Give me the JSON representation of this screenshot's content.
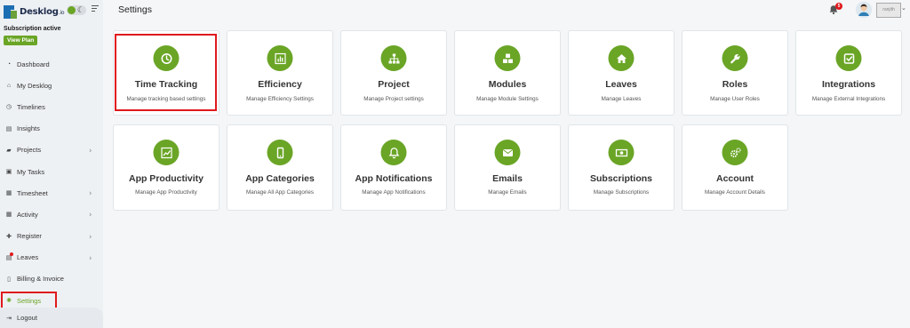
{
  "brand": {
    "name": "Desklog",
    "suffix": ".io"
  },
  "subscription": {
    "status": "Subscription active",
    "view_plan_label": "View Plan"
  },
  "nav": {
    "items": [
      {
        "label": "Dashboard",
        "icon": "dashboard-icon",
        "has_submenu": false
      },
      {
        "label": "My Desklog",
        "icon": "home-icon",
        "has_submenu": false
      },
      {
        "label": "Timelines",
        "icon": "clock-icon",
        "has_submenu": false
      },
      {
        "label": "Insights",
        "icon": "file-icon",
        "has_submenu": false
      },
      {
        "label": "Projects",
        "icon": "folder-icon",
        "has_submenu": true
      },
      {
        "label": "My Tasks",
        "icon": "tasks-icon",
        "has_submenu": false
      },
      {
        "label": "Timesheet",
        "icon": "calendar-icon",
        "has_submenu": true
      },
      {
        "label": "Activity",
        "icon": "grid-icon",
        "has_submenu": true
      },
      {
        "label": "Register",
        "icon": "plus-icon",
        "has_submenu": true
      },
      {
        "label": "Leaves",
        "icon": "leaves-icon",
        "has_submenu": true
      },
      {
        "label": "Billing & Invoice",
        "icon": "invoice-icon",
        "has_submenu": false
      },
      {
        "label": "Settings",
        "icon": "gear-icon",
        "has_submenu": false,
        "active": true
      },
      {
        "label": "Logout",
        "icon": "logout-icon",
        "has_submenu": false
      }
    ]
  },
  "header": {
    "title": "Settings",
    "notification_count": "5",
    "user_name": "ranjith"
  },
  "cards": [
    {
      "title": "Time Tracking",
      "desc": "Manage tracking based settings",
      "icon": "clock-icon"
    },
    {
      "title": "Efficiency",
      "desc": "Manage Efficiency Settings",
      "icon": "bar-chart-icon"
    },
    {
      "title": "Project",
      "desc": "Manage Project settings",
      "icon": "sitemap-icon"
    },
    {
      "title": "Modules",
      "desc": "Manage Module Settings",
      "icon": "cubes-icon"
    },
    {
      "title": "Leaves",
      "desc": "Manage Leaves",
      "icon": "home-icon"
    },
    {
      "title": "Roles",
      "desc": "Manage User Roles",
      "icon": "wrench-icon"
    },
    {
      "title": "Integrations",
      "desc": "Manage External Integrations",
      "icon": "check-square-icon"
    },
    {
      "title": "App Productivity",
      "desc": "Manage App Productivity",
      "icon": "trend-chart-icon"
    },
    {
      "title": "App Categories",
      "desc": "Manage All App Categories",
      "icon": "mobile-icon"
    },
    {
      "title": "App Notifications",
      "desc": "Manage App Notifications",
      "icon": "bell-icon"
    },
    {
      "title": "Emails",
      "desc": "Manage Emails",
      "icon": "envelope-icon"
    },
    {
      "title": "Subscriptions",
      "desc": "Manage Subscriptions",
      "icon": "money-icon"
    },
    {
      "title": "Account",
      "desc": "Manage Account Details",
      "icon": "cogs-icon"
    }
  ],
  "colors": {
    "accent": "#6aa526",
    "highlight": "#e0191c",
    "brand_blue": "#1d6fb3"
  }
}
